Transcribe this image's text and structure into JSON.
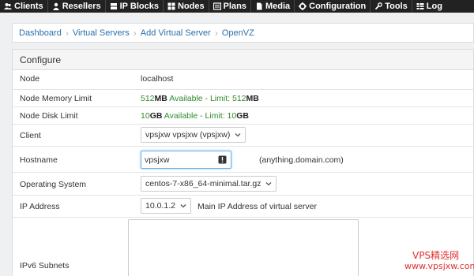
{
  "nav": {
    "items": [
      {
        "label": "Clients",
        "icon": "users-icon"
      },
      {
        "label": "Resellers",
        "icon": "user-icon"
      },
      {
        "label": "IP Blocks",
        "icon": "server-icon"
      },
      {
        "label": "Nodes",
        "icon": "nodes-icon"
      },
      {
        "label": "Plans",
        "icon": "list-icon"
      },
      {
        "label": "Media",
        "icon": "file-icon"
      },
      {
        "label": "Configuration",
        "icon": "gear-icon"
      },
      {
        "label": "Tools",
        "icon": "wrench-icon"
      },
      {
        "label": "Log",
        "icon": "table-icon"
      }
    ]
  },
  "breadcrumb": [
    "Dashboard",
    "Virtual Servers",
    "Add Virtual Server",
    "OpenVZ"
  ],
  "panel": {
    "title": "Configure",
    "node": {
      "label": "Node",
      "value": "localhost"
    },
    "memory": {
      "label": "Node Memory Limit",
      "avail_num": "512",
      "avail_unit": "MB",
      "avail_text": " Available",
      "limit_text": " - Limit: ",
      "limit_num": "512",
      "limit_unit": "MB"
    },
    "disk": {
      "label": "Node Disk Limit",
      "avail_num": "10",
      "avail_unit": "GB",
      "avail_text": " Available",
      "limit_text": " - Limit: ",
      "limit_num": "10",
      "limit_unit": "GB"
    },
    "client": {
      "label": "Client",
      "selected": "vpsjxw vpsjxw (vpsjxw)"
    },
    "hostname": {
      "label": "Hostname",
      "value": "vpsjxw",
      "hint": "(anything.domain.com)"
    },
    "os": {
      "label": "Operating System",
      "selected": "centos-7-x86_64-minimal.tar.gz"
    },
    "ip": {
      "label": "IP Address",
      "selected": "10.0.1.2",
      "hint": "Main IP Address of virtual server"
    },
    "ipv6": {
      "label": "IPv6 Subnets"
    }
  },
  "watermark": {
    "line1": "VPS精选网",
    "line2": "www.vpsjxw.com"
  },
  "colors": {
    "nav_bg": "#222222",
    "link": "#2a6fa8",
    "available": "#2e8b2e"
  }
}
